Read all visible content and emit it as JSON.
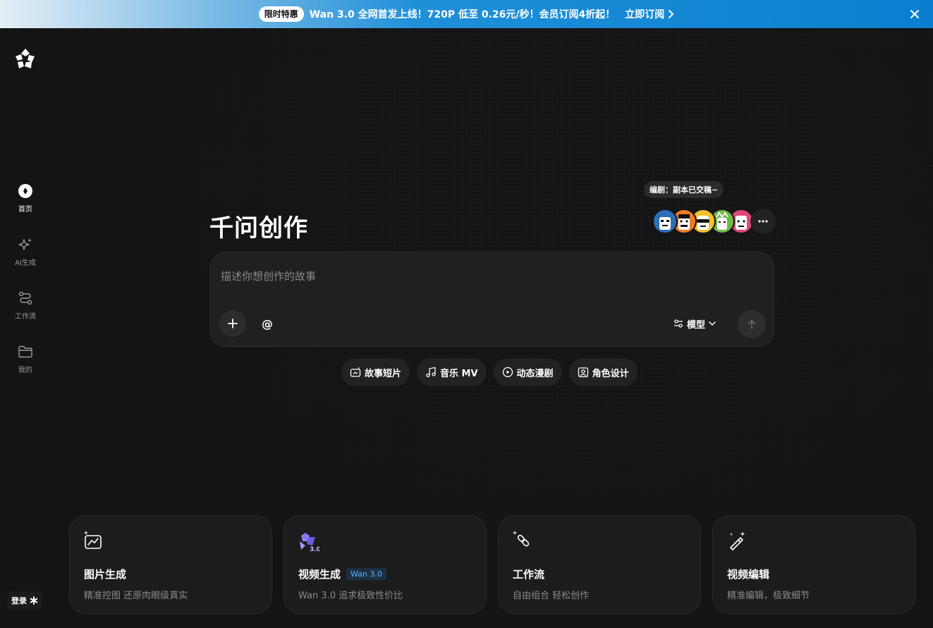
{
  "banner": {
    "tag": "限时特惠",
    "text": "Wan 3.0 全网首发上线！720P 低至 0.26元/秒！会员订阅4折起！",
    "link": "立即订阅"
  },
  "sidebar": {
    "items": [
      {
        "label": "首页",
        "icon": "home-icon"
      },
      {
        "label": "AI生成",
        "icon": "sparkle-icon"
      },
      {
        "label": "工作流",
        "icon": "workflow-icon"
      },
      {
        "label": "我的",
        "icon": "folder-icon"
      }
    ],
    "login_label": "登录"
  },
  "main": {
    "title": "千问创作",
    "tooltip": "编剧：副本已交稿~",
    "prompt": {
      "placeholder": "描述你想创作的故事",
      "at_symbol": "@",
      "model_label": "模型"
    },
    "chips": [
      {
        "label": "故事短片",
        "icon": "story-icon"
      },
      {
        "label": "音乐 MV",
        "icon": "music-icon"
      },
      {
        "label": "动态漫剧",
        "icon": "play-circle-icon"
      },
      {
        "label": "角色设计",
        "icon": "portrait-icon"
      }
    ],
    "cards": [
      {
        "title": "图片生成",
        "subtitle": "精准控图 还原肉眼级真实",
        "icon": "image-chart-icon"
      },
      {
        "title": "视频生成",
        "badge": "Wan 3.0",
        "subtitle": "Wan 3.0 追求极致性价比",
        "icon": "wan-logo-icon"
      },
      {
        "title": "工作流",
        "subtitle": "自由组合 轻松创作",
        "icon": "link-sparkle-icon"
      },
      {
        "title": "视频编辑",
        "subtitle": "精准编辑，极致细节",
        "icon": "magic-wand-icon"
      }
    ]
  },
  "colors": {
    "background": "#141414",
    "accent": "#0a7fcf",
    "badge_text": "#5ab4ff"
  }
}
